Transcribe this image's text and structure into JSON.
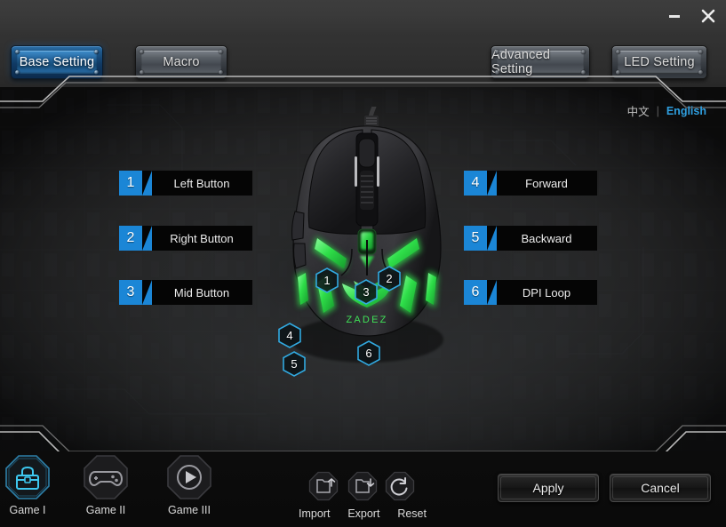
{
  "window": {
    "minimize_label": "−",
    "close_label": "×",
    "minimize_icon": "minimize-icon",
    "close_icon": "close-icon"
  },
  "tabs": [
    {
      "id": "base",
      "label": "Base Setting",
      "active": true
    },
    {
      "id": "macro",
      "label": "Macro",
      "active": false
    },
    {
      "id": "advanced",
      "label": "Advanced Setting",
      "active": false
    },
    {
      "id": "led",
      "label": "LED Setting",
      "active": false
    }
  ],
  "language": {
    "chinese": "中文",
    "separator": "|",
    "english": "English",
    "active": "English",
    "active_color": "#2f9fe0"
  },
  "button_map": {
    "left_column": [
      {
        "number": "1",
        "label": "Left Button"
      },
      {
        "number": "2",
        "label": "Right Button"
      },
      {
        "number": "3",
        "label": "Mid Button"
      }
    ],
    "right_column": [
      {
        "number": "4",
        "label": "Forward"
      },
      {
        "number": "5",
        "label": "Backward"
      },
      {
        "number": "6",
        "label": "DPI Loop"
      }
    ],
    "number_badge_color": "#1b86d6"
  },
  "device": {
    "brand_logo_text": "ZADEZ",
    "led_color": "#2fe04a",
    "callouts": [
      {
        "number": "1",
        "target": "left-button"
      },
      {
        "number": "2",
        "target": "right-button"
      },
      {
        "number": "3",
        "target": "mid-button"
      },
      {
        "number": "4",
        "target": "forward"
      },
      {
        "number": "5",
        "target": "backward"
      },
      {
        "number": "6",
        "target": "dpi-loop"
      }
    ],
    "callout_border_color": "#31a9e0"
  },
  "profiles": [
    {
      "id": "game-1",
      "label": "Game I",
      "icon": "toolbox-icon",
      "active": true
    },
    {
      "id": "game-2",
      "label": "Game II",
      "icon": "gamepad-icon",
      "active": false
    },
    {
      "id": "game-3",
      "label": "Game III",
      "icon": "play-circle-icon",
      "active": false
    }
  ],
  "tools": [
    {
      "id": "import",
      "label": "Import",
      "icon": "import-file-icon"
    },
    {
      "id": "export",
      "label": "Export",
      "icon": "export-file-icon"
    },
    {
      "id": "reset",
      "label": "Reset",
      "icon": "refresh-icon"
    }
  ],
  "actions": {
    "apply_label": "Apply",
    "cancel_label": "Cancel"
  },
  "theme": {
    "accent_blue": "#1b86d6",
    "active_tab_blue": "#2a6ea8",
    "glow_cyan": "#31a9e0",
    "background_dark": "#121212",
    "titlebar_gray": "#3a3a3a"
  }
}
